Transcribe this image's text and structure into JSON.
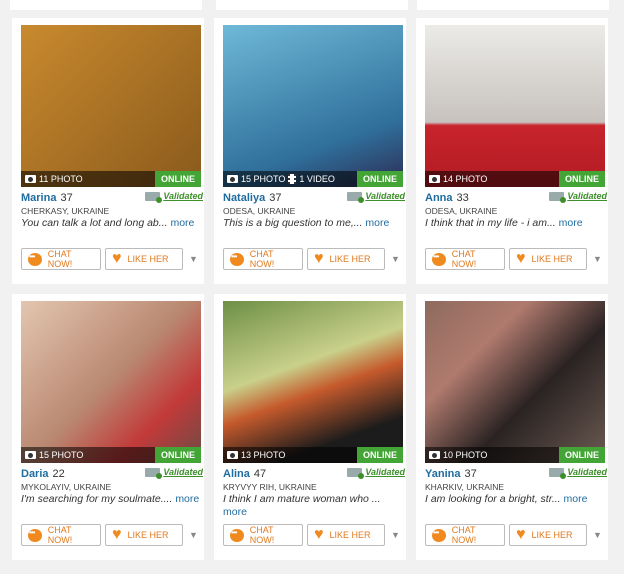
{
  "buttons": {
    "chat": "CHAT NOW!",
    "like": "LIKE HER"
  },
  "badges": {
    "online": "ONLINE",
    "validated": "Validated"
  },
  "colors": {
    "name_blue": "#1f6ca0",
    "online_green": "#43a535",
    "accent_orange": "#f08a1f",
    "validated_green": "#3d8f2a"
  },
  "profiles": [
    {
      "name": "Marina",
      "age": "37",
      "city": "CHERKASY, UKRAINE",
      "photos": "11 PHOTO",
      "videos": "",
      "bio": "You can talk a lot and long ab...",
      "more": "more",
      "photo_color": "#b07a2a"
    },
    {
      "name": "Nataliya",
      "age": "37",
      "city": "ODESA, UKRAINE",
      "photos": "15 PHOTO",
      "videos": "1 VIDEO",
      "bio": "This is a big question to me,...",
      "more": "more",
      "photo_color": "#5fa6c8"
    },
    {
      "name": "Anna",
      "age": "33",
      "city": "ODESA, UKRAINE",
      "photos": "14 PHOTO",
      "videos": "",
      "bio": "I think that in my life - i am...",
      "more": "more",
      "photo_color": "#d9d6d2"
    },
    {
      "name": "Daria",
      "age": "22",
      "city": "MYKOLAYIV, UKRAINE",
      "photos": "15 PHOTO",
      "videos": "",
      "bio": "I'm searching for my soulmate....",
      "more": "more",
      "photo_color": "#c9a08a"
    },
    {
      "name": "Alina",
      "age": "47",
      "city": "KRYVYY RIH, UKRAINE",
      "photos": "13 PHOTO",
      "videos": "",
      "bio": "I think I am mature woman who ...",
      "more": "more",
      "photo_color": "#5d7f3e"
    },
    {
      "name": "Yanina",
      "age": "37",
      "city": "KHARKIV, UKRAINE",
      "photos": "10 PHOTO",
      "videos": "",
      "bio": "I am looking for a bright, str...",
      "more": "more",
      "photo_color": "#7d6358"
    }
  ]
}
